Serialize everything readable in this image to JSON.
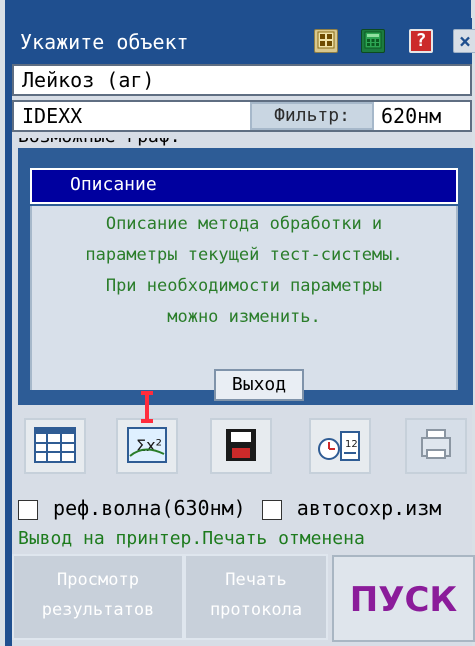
{
  "window": {
    "title": "Укажите объект",
    "icons": [
      "calculator-icon",
      "green-calculator-icon",
      "help-icon",
      "close-icon"
    ],
    "help_label": "?",
    "close_label": "×"
  },
  "fields": {
    "object_value": "Лейкоз (аг)",
    "system_value": "IDEXX",
    "filter_button": "Фильтр:",
    "filter_value": "620нм"
  },
  "dialog": {
    "title": "Описание",
    "lines": [
      "Описание метода обработки и",
      "параметры текущей тест-системы.",
      "При необходимости параметры",
      "можно изменить."
    ],
    "exit_label": "Выход"
  },
  "section": {
    "label": "Возможные граф."
  },
  "toolbar": {
    "tools": [
      "table-grid-icon",
      "sigma-x2-icon",
      "save-icon",
      "sequence-clock-icon",
      "printer-icon"
    ]
  },
  "checks": {
    "ref_wave": "реф.волна(630нм)",
    "autosave": "автосохр.изм"
  },
  "status": {
    "printer": "Вывод на принтер.Печать отменена"
  },
  "buttons": {
    "view_results_line1": "Просмотр",
    "view_results_line2": "результатов",
    "print_protocol_line1": "Печать",
    "print_protocol_line2": "протокола",
    "start": "ПУСК"
  },
  "colors": {
    "titlebar": "#1f4f8f",
    "dialog_header": "#00009f",
    "text_green": "#2a7d2a",
    "start_purple": "#8b1c9a"
  }
}
